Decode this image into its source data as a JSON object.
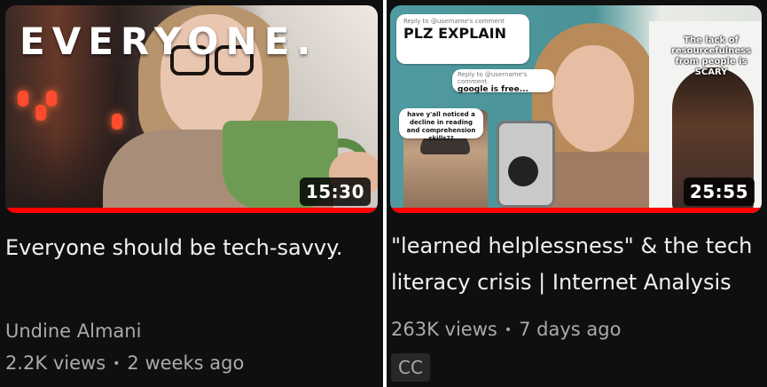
{
  "videos": [
    {
      "thumbnail_text": "EVERYONE.",
      "duration": "15:30",
      "watch_progress_percent": 100,
      "title": "Everyone should be tech-savvy.",
      "channel": "Undine Almani",
      "views": "2.2K views",
      "age": "2 weeks ago"
    },
    {
      "thumbnail_bubble_1_header": "Reply to @username's comment",
      "thumbnail_bubble_1_text": "PLZ EXPLAIN",
      "thumbnail_bubble_2_header": "Reply to @username's comment",
      "thumbnail_bubble_2_text": "google is free...",
      "thumbnail_bubble_3_text": "have y'all noticed a decline in reading and comprehension skills??",
      "thumbnail_caption": "The lack of resourcefulness from people is SCARY",
      "duration": "25:55",
      "watch_progress_percent": 100,
      "title": "\"learned helplessness\" & the tech literacy crisis | Internet Analysis",
      "views": "263K views",
      "age": "7 days ago",
      "badge": "CC"
    }
  ],
  "colors": {
    "background": "#0f0f0f",
    "progress": "#ff0000",
    "title_text": "#f1f1f1",
    "meta_text": "#aaaaaa"
  }
}
